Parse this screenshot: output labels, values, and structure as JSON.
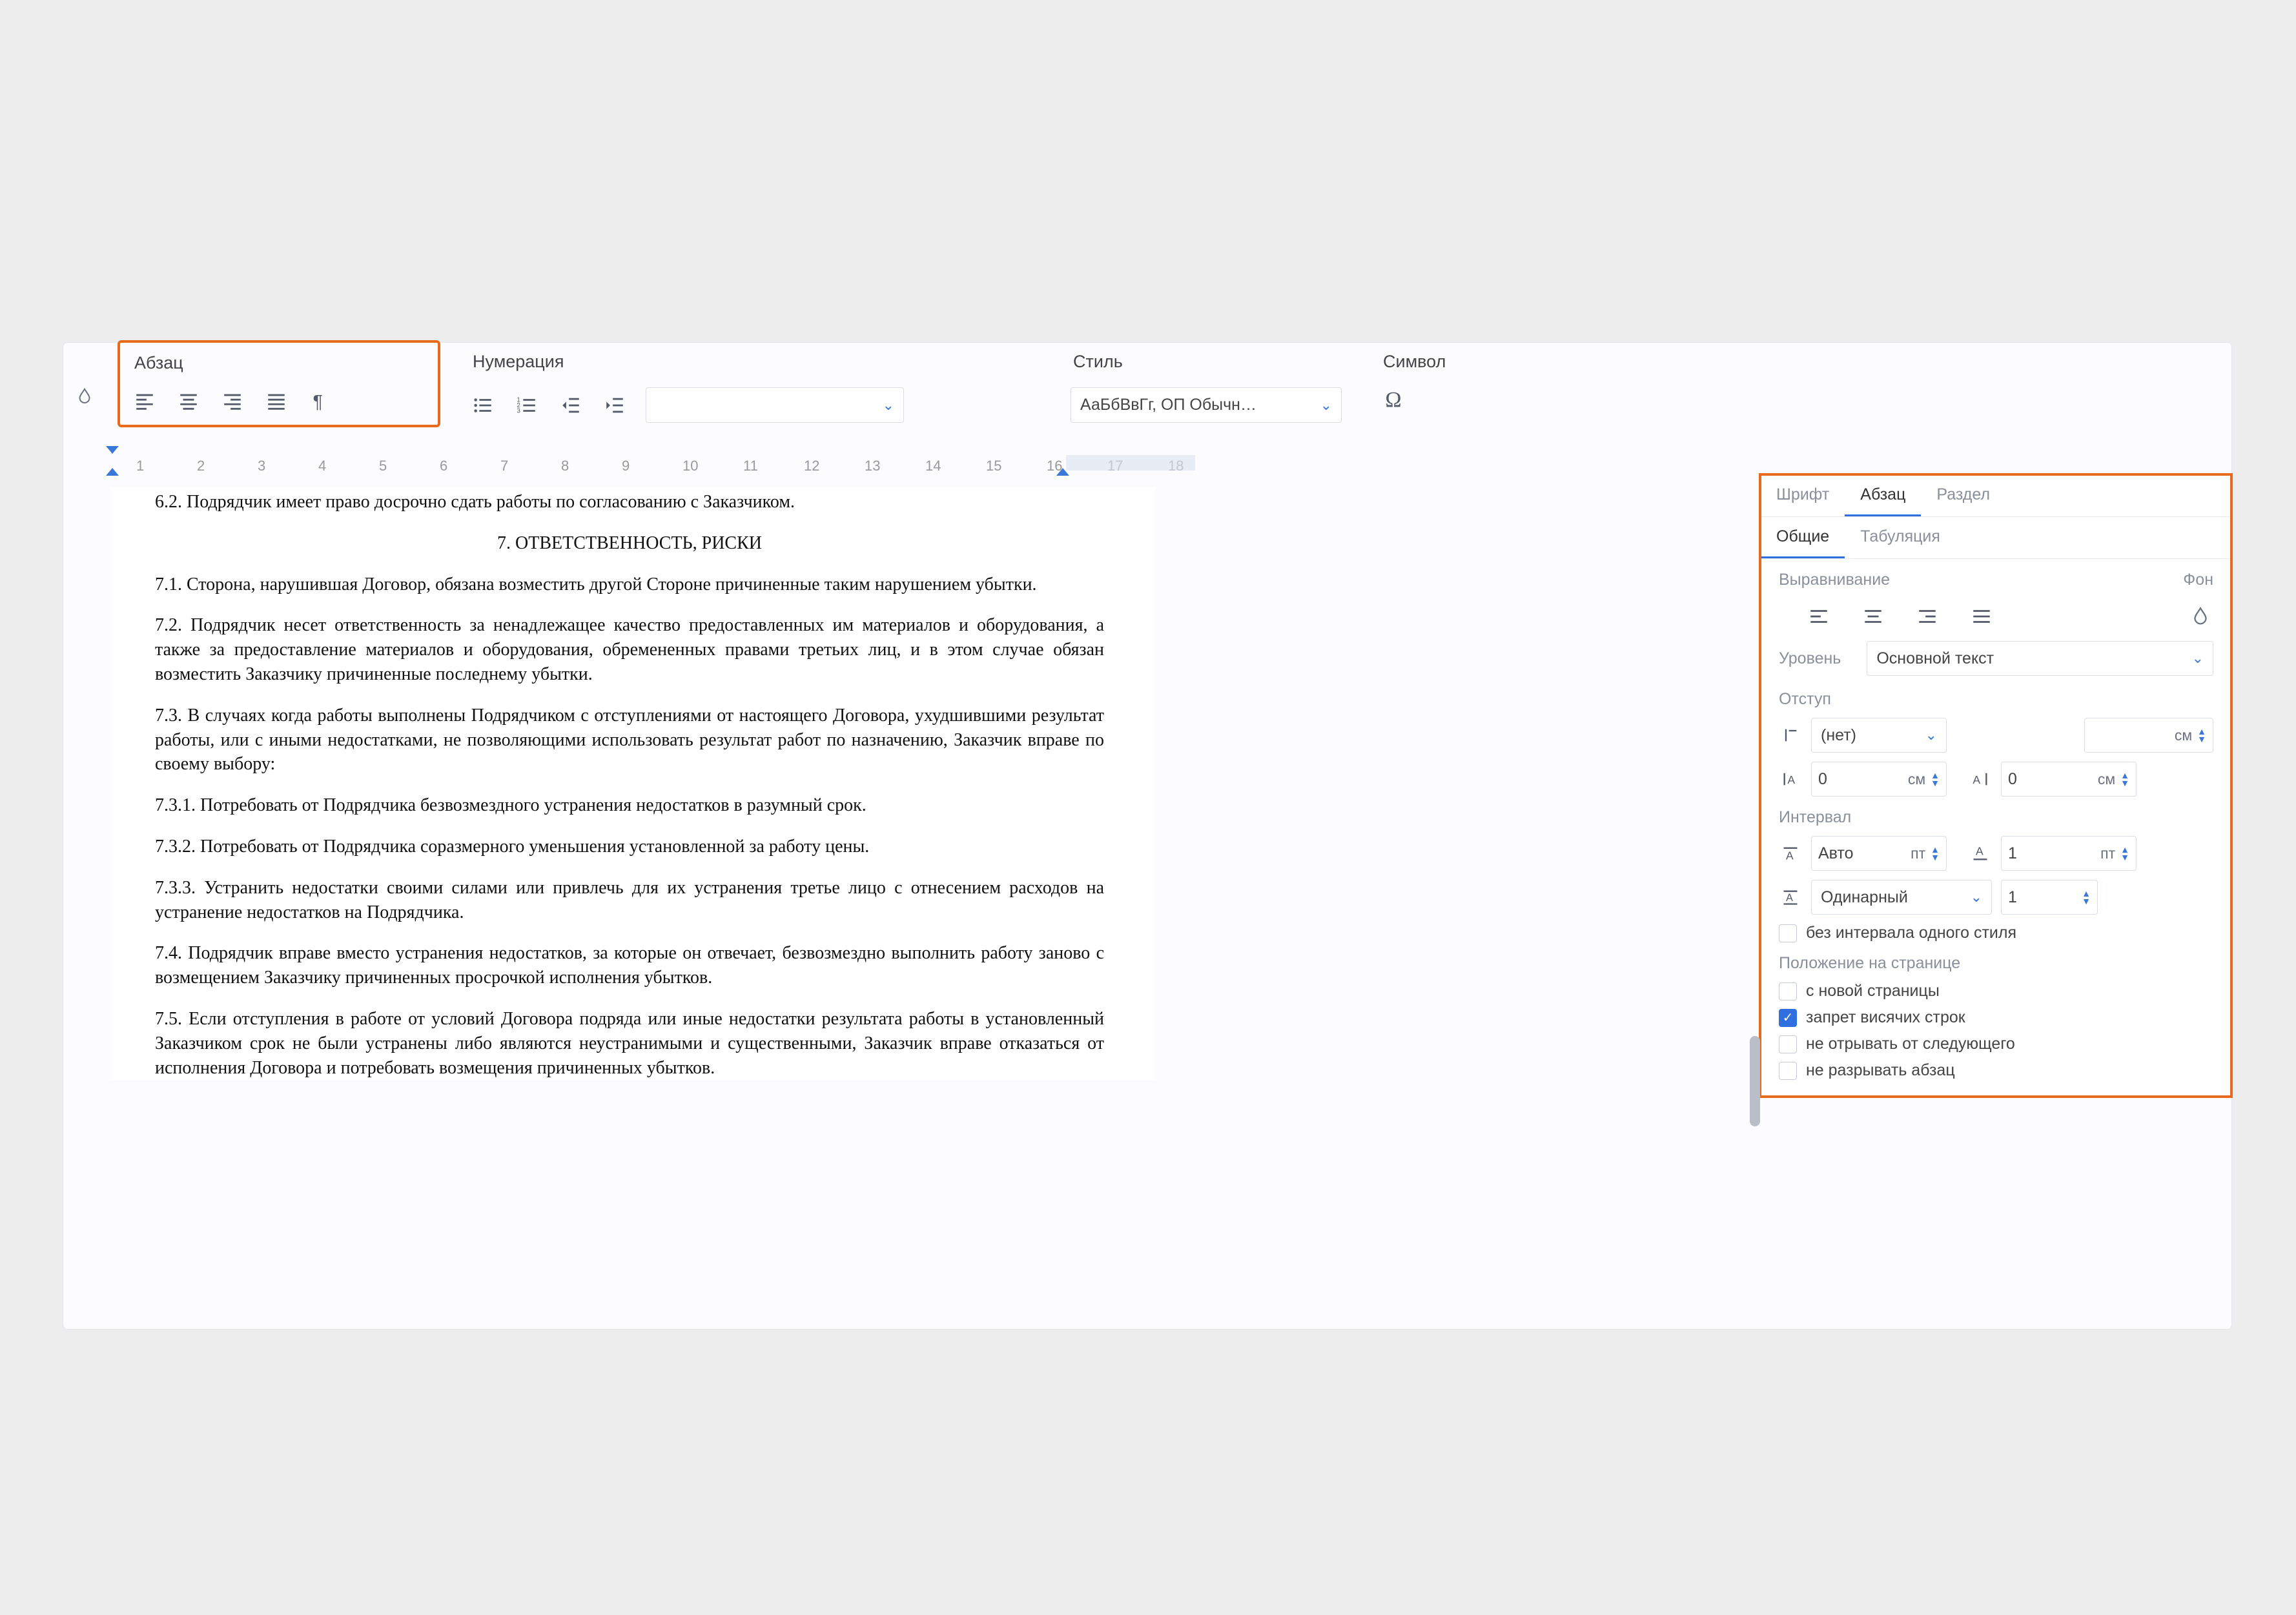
{
  "toolbar": {
    "groups": {
      "paragraph": {
        "title": "Абзац"
      },
      "numbering": {
        "title": "Нумерация"
      },
      "style": {
        "title": "Стиль",
        "value": "АаБбВвГг,  ОП Обычн…"
      },
      "symbol": {
        "title": "Символ",
        "glyph": "Ω"
      }
    }
  },
  "ruler": {
    "ticks": [
      "1",
      "2",
      "3",
      "4",
      "5",
      "6",
      "7",
      "8",
      "9",
      "10",
      "11",
      "12",
      "13",
      "14",
      "15",
      "16",
      "17",
      "18"
    ]
  },
  "doc": {
    "p62": "6.2. Подрядчик имеет право досрочно сдать работы по согласованию с Заказчиком.",
    "h7": "7. ОТВЕТСТВЕННОСТЬ, РИСКИ",
    "p71": "7.1. Сторона, нарушившая Договор, обязана возместить другой Стороне причиненные таким нарушением убытки.",
    "p72": "7.2. Подрядчик несет ответственность за ненадлежащее качество предоставленных им материалов и оборудования, а также за предоставление материалов и оборудования, обремененных правами третьих лиц, и в этом случае обязан возместить Заказчику причиненные последнему убытки.",
    "p73": "7.3. В случаях когда работы выполнены Подрядчиком с отступлениями от настоящего Договора, ухудшившими результат работы, или с иными недостатками, не позволяющими использовать результат работ по назначению, Заказчик вправе по своему выбору:",
    "p731": "7.3.1. Потребовать от Подрядчика безвозмездного устранения недостатков в разумный срок.",
    "p732": "7.3.2. Потребовать от Подрядчика соразмерного уменьшения установленной за работу цены.",
    "p733": "7.3.3. Устранить недостатки своими силами или привлечь для их устранения третье лицо с отнесением расходов на устранение недостатков на Подрядчика.",
    "p74": "7.4. Подрядчик вправе вместо устранения недостатков, за которые он отвечает, безвозмездно выполнить работу заново с возмещением Заказчику причиненных просрочкой исполнения убытков.",
    "p75": "7.5. Если отступления в работе от условий Договора подряда или иные недостатки результата работы в установленный Заказчиком срок не были устранены либо являются неустранимыми и существенными, Заказчик вправе отказаться от исполнения Договора и потребовать возмещения причиненных убытков."
  },
  "panel": {
    "tabs1": {
      "font": "Шрифт",
      "para": "Абзац",
      "section": "Раздел"
    },
    "tabs2": {
      "general": "Общие",
      "tabstops": "Табуляция"
    },
    "labels": {
      "alignment": "Выравнивание",
      "background": "Фон",
      "level": "Уровень",
      "indent": "Отступ",
      "interval": "Интервал",
      "page_pos": "Положение на странице"
    },
    "level_value": "Основной текст",
    "indent": {
      "first_line": "(нет)",
      "first_unit": "см",
      "left": "0",
      "left_unit": "см",
      "right": "0",
      "right_unit": "см"
    },
    "interval": {
      "before": "Авто",
      "before_unit": "пт",
      "after": "1",
      "after_unit": "пт",
      "line": "Одинарный",
      "line_mult": "1"
    },
    "checks": {
      "same_style_no_space": "без интервала одного стиля",
      "page_break_before": "с новой страницы",
      "widow_control": "запрет висячих строк",
      "keep_with_next": "не отрывать от следующего",
      "keep_lines": "не разрывать абзац"
    }
  }
}
